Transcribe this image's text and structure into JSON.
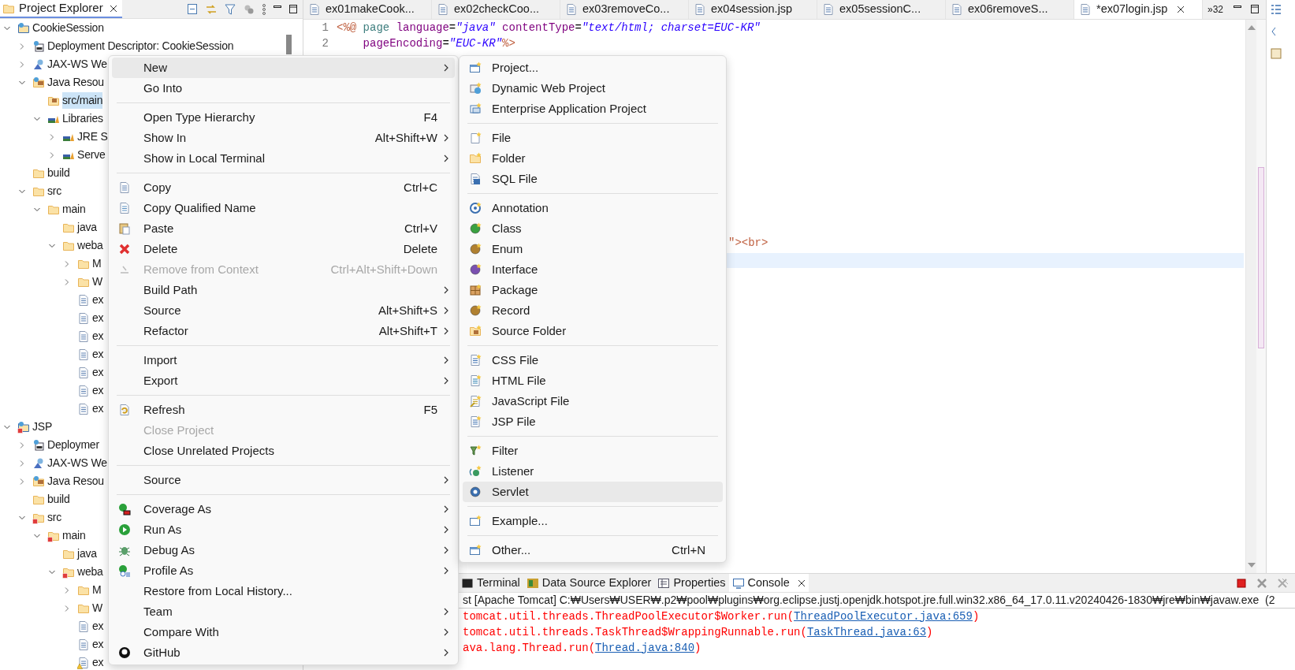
{
  "explorer": {
    "title": "Project Explorer",
    "tree": [
      {
        "label": "CookieSession",
        "kind": "project",
        "expanded": true,
        "children": [
          {
            "label": "Deployment Descriptor: CookieSession",
            "kind": "descriptor",
            "expanded": false
          },
          {
            "label": "JAX-WS We",
            "kind": "webservice",
            "expanded": false
          },
          {
            "label": "Java Resou",
            "kind": "java-resources",
            "expanded": true,
            "children": [
              {
                "label": "src/main",
                "kind": "package-root",
                "selected": true
              },
              {
                "label": "Libraries",
                "kind": "library",
                "expanded": true,
                "children": [
                  {
                    "label": "JRE S",
                    "kind": "library",
                    "expanded": false
                  },
                  {
                    "label": "Serve",
                    "kind": "library",
                    "expanded": false
                  }
                ]
              }
            ]
          },
          {
            "label": "build",
            "kind": "folder"
          },
          {
            "label": "src",
            "kind": "folder",
            "expanded": true,
            "children": [
              {
                "label": "main",
                "kind": "folder",
                "expanded": true,
                "children": [
                  {
                    "label": "java",
                    "kind": "folder"
                  },
                  {
                    "label": "weba",
                    "kind": "folder",
                    "expanded": true,
                    "children": [
                      {
                        "label": "M",
                        "kind": "folder",
                        "expanded": false
                      },
                      {
                        "label": "W",
                        "kind": "folder",
                        "expanded": false
                      },
                      {
                        "label": "ex",
                        "kind": "file"
                      },
                      {
                        "label": "ex",
                        "kind": "file"
                      },
                      {
                        "label": "ex",
                        "kind": "file"
                      },
                      {
                        "label": "ex",
                        "kind": "file"
                      },
                      {
                        "label": "ex",
                        "kind": "file"
                      },
                      {
                        "label": "ex",
                        "kind": "file"
                      },
                      {
                        "label": "ex",
                        "kind": "file"
                      }
                    ]
                  }
                ]
              }
            ]
          }
        ]
      },
      {
        "label": "JSP",
        "kind": "project-error",
        "expanded": true,
        "children": [
          {
            "label": "Deploymer",
            "kind": "descriptor",
            "expanded": false
          },
          {
            "label": "JAX-WS We",
            "kind": "webservice",
            "expanded": false
          },
          {
            "label": "Java Resou",
            "kind": "java-resources",
            "expanded": false
          },
          {
            "label": "build",
            "kind": "folder"
          },
          {
            "label": "src",
            "kind": "folder-error",
            "expanded": true,
            "children": [
              {
                "label": "main",
                "kind": "folder-error",
                "expanded": true,
                "children": [
                  {
                    "label": "java",
                    "kind": "folder"
                  },
                  {
                    "label": "weba",
                    "kind": "folder-error",
                    "expanded": true,
                    "children": [
                      {
                        "label": "M",
                        "kind": "folder",
                        "expanded": false
                      },
                      {
                        "label": "W",
                        "kind": "folder",
                        "expanded": false
                      },
                      {
                        "label": "ex",
                        "kind": "file"
                      },
                      {
                        "label": "ex",
                        "kind": "file"
                      },
                      {
                        "label": "ex",
                        "kind": "file-warning"
                      }
                    ]
                  }
                ]
              }
            ]
          }
        ]
      }
    ]
  },
  "editor": {
    "tabs": [
      {
        "label": "ex01makeCook...",
        "selected": false
      },
      {
        "label": "ex02checkCoo...",
        "selected": false
      },
      {
        "label": "ex03removeCo...",
        "selected": false
      },
      {
        "label": "ex04session.jsp",
        "selected": false
      },
      {
        "label": "ex05sessionC...",
        "selected": false
      },
      {
        "label": "ex06removeS...",
        "selected": false
      },
      {
        "label": "*ex07login.jsp",
        "selected": true
      }
    ],
    "overflow": "»32",
    "lines": [
      {
        "number": "1",
        "segments": [
          {
            "text": "<%@ ",
            "kind": "tag"
          },
          {
            "text": "page ",
            "kind": "keyword"
          },
          {
            "text": "language",
            "kind": "attr"
          },
          {
            "text": "=",
            "kind": "plain"
          },
          {
            "text": "\"java\"",
            "kind": "value"
          },
          {
            "text": " contentType",
            "kind": "attr"
          },
          {
            "text": "=",
            "kind": "plain"
          },
          {
            "text": "\"text/html; charset=EUC-KR\"",
            "kind": "value"
          }
        ]
      },
      {
        "number": "2",
        "segments": [
          {
            "text": "    pageEncoding",
            "kind": "attr"
          },
          {
            "text": "=",
            "kind": "plain"
          },
          {
            "text": "\"EUC-KR\"",
            "kind": "value"
          },
          {
            "text": "%>",
            "kind": "tag"
          }
        ]
      }
    ],
    "fragment": [
      {
        "text": "\"><br>",
        "kind": "tag"
      }
    ]
  },
  "console": {
    "tabs": [
      {
        "label": "Terminal",
        "kind": "terminal",
        "selected": false
      },
      {
        "label": "Data Source Explorer",
        "kind": "database",
        "selected": false
      },
      {
        "label": "Properties",
        "kind": "properties",
        "selected": false
      },
      {
        "label": "Console",
        "kind": "console",
        "selected": true
      }
    ],
    "header": "st [Apache Tomcat] C:₩Users₩USER₩.p2₩pool₩plugins₩org.eclipse.justj.openjdk.hotspot.jre.full.win32.x86_64_17.0.11.v20240426-1830₩jre₩bin₩javaw.exe  (2",
    "lines": [
      [
        {
          "kind": "text",
          "text": "tomcat.util.threads.ThreadPoolExecutor$Worker.run("
        },
        {
          "kind": "link",
          "text": "ThreadPoolExecutor.java:659"
        },
        {
          "kind": "text",
          "text": ")"
        }
      ],
      [
        {
          "kind": "text",
          "text": "tomcat.util.threads.TaskThread$WrappingRunnable.run("
        },
        {
          "kind": "link",
          "text": "TaskThread.java:63"
        },
        {
          "kind": "text",
          "text": ")"
        }
      ],
      [
        {
          "kind": "text",
          "text": "ava.lang.Thread.run("
        },
        {
          "kind": "link",
          "text": "Thread.java:840"
        },
        {
          "kind": "text",
          "text": ")"
        }
      ]
    ]
  },
  "context_menu": [
    {
      "kind": "item",
      "label": "New",
      "submenu": true,
      "selected": true,
      "disabled": false
    },
    {
      "kind": "item",
      "label": "Go Into",
      "submenu": false,
      "selected": false,
      "disabled": false
    },
    {
      "kind": "separator"
    },
    {
      "kind": "item",
      "label": "Open Type Hierarchy",
      "shortcut": "F4",
      "submenu": false,
      "selected": false,
      "disabled": false
    },
    {
      "kind": "item",
      "label": "Show In",
      "shortcut": "Alt+Shift+W",
      "submenu": true,
      "selected": false,
      "disabled": false
    },
    {
      "kind": "item",
      "label": "Show in Local Terminal",
      "submenu": true,
      "selected": false,
      "disabled": false
    },
    {
      "kind": "separator"
    },
    {
      "kind": "copy",
      "label": "Copy",
      "shortcut": "Ctrl+C",
      "submenu": false,
      "selected": false,
      "disabled": false
    },
    {
      "kind": "copy-name",
      "label": "Copy Qualified Name",
      "submenu": false,
      "selected": false,
      "disabled": false
    },
    {
      "kind": "paste",
      "label": "Paste",
      "shortcut": "Ctrl+V",
      "submenu": false,
      "selected": false,
      "disabled": false
    },
    {
      "kind": "delete",
      "label": "Delete",
      "shortcut": "Delete",
      "submenu": false,
      "selected": false,
      "disabled": false
    },
    {
      "kind": "remove",
      "label": "Remove from Context",
      "shortcut": "Ctrl+Alt+Shift+Down",
      "submenu": false,
      "selected": false,
      "disabled": true
    },
    {
      "kind": "item",
      "label": "Build Path",
      "submenu": true,
      "selected": false,
      "disabled": false
    },
    {
      "kind": "item",
      "label": "Source",
      "shortcut": "Alt+Shift+S",
      "submenu": true,
      "selected": false,
      "disabled": false
    },
    {
      "kind": "item",
      "label": "Refactor",
      "shortcut": "Alt+Shift+T",
      "submenu": true,
      "selected": false,
      "disabled": false
    },
    {
      "kind": "separator"
    },
    {
      "kind": "item",
      "label": "Import",
      "submenu": true,
      "selected": false,
      "disabled": false
    },
    {
      "kind": "item",
      "label": "Export",
      "submenu": true,
      "selected": false,
      "disabled": false
    },
    {
      "kind": "separator"
    },
    {
      "kind": "refresh",
      "label": "Refresh",
      "shortcut": "F5",
      "submenu": false,
      "selected": false,
      "disabled": false
    },
    {
      "kind": "item",
      "label": "Close Project",
      "submenu": false,
      "selected": false,
      "disabled": true
    },
    {
      "kind": "item",
      "label": "Close Unrelated Projects",
      "submenu": false,
      "selected": false,
      "disabled": false
    },
    {
      "kind": "separator"
    },
    {
      "kind": "item",
      "label": "Source",
      "submenu": true,
      "selected": false,
      "disabled": false
    },
    {
      "kind": "separator"
    },
    {
      "kind": "coverage",
      "label": "Coverage As",
      "submenu": true,
      "selected": false,
      "disabled": false
    },
    {
      "kind": "run",
      "label": "Run As",
      "submenu": true,
      "selected": false,
      "disabled": false
    },
    {
      "kind": "debug",
      "label": "Debug As",
      "submenu": true,
      "selected": false,
      "disabled": false
    },
    {
      "kind": "profile",
      "label": "Profile As",
      "submenu": true,
      "selected": false,
      "disabled": false
    },
    {
      "kind": "item",
      "label": "Restore from Local History...",
      "submenu": false,
      "selected": false,
      "disabled": false
    },
    {
      "kind": "item",
      "label": "Team",
      "submenu": true,
      "selected": false,
      "disabled": false
    },
    {
      "kind": "item",
      "label": "Compare With",
      "submenu": true,
      "selected": false,
      "disabled": false
    },
    {
      "kind": "github",
      "label": "GitHub",
      "submenu": true,
      "selected": false,
      "disabled": false
    }
  ],
  "new_submenu": [
    {
      "kind": "project-new",
      "label": "Project...",
      "selected": false
    },
    {
      "kind": "web-project",
      "label": "Dynamic Web Project",
      "selected": false
    },
    {
      "kind": "ear-project",
      "label": "Enterprise Application Project",
      "selected": false
    },
    {
      "kind": "separator"
    },
    {
      "kind": "file-new",
      "label": "File",
      "selected": false
    },
    {
      "kind": "folder-new",
      "label": "Folder",
      "selected": false
    },
    {
      "kind": "sql-file",
      "label": "SQL File",
      "selected": false
    },
    {
      "kind": "separator"
    },
    {
      "kind": "annotation",
      "label": "Annotation",
      "selected": false
    },
    {
      "kind": "class",
      "label": "Class",
      "selected": false
    },
    {
      "kind": "enum",
      "label": "Enum",
      "selected": false
    },
    {
      "kind": "interface",
      "label": "Interface",
      "selected": false
    },
    {
      "kind": "package",
      "label": "Package",
      "selected": false
    },
    {
      "kind": "record",
      "label": "Record",
      "selected": false
    },
    {
      "kind": "source-folder",
      "label": "Source Folder",
      "selected": false
    },
    {
      "kind": "separator"
    },
    {
      "kind": "css-file",
      "label": "CSS File",
      "selected": false
    },
    {
      "kind": "html-file",
      "label": "HTML File",
      "selected": false
    },
    {
      "kind": "js-file",
      "label": "JavaScript File",
      "selected": false
    },
    {
      "kind": "jsp-file",
      "label": "JSP File",
      "selected": false
    },
    {
      "kind": "separator"
    },
    {
      "kind": "filter",
      "label": "Filter",
      "selected": false
    },
    {
      "kind": "listener",
      "label": "Listener",
      "selected": false
    },
    {
      "kind": "servlet",
      "label": "Servlet",
      "selected": true
    },
    {
      "kind": "separator"
    },
    {
      "kind": "example",
      "label": "Example...",
      "selected": false
    },
    {
      "kind": "separator"
    },
    {
      "kind": "other",
      "label": "Other...",
      "shortcut": "Ctrl+N",
      "selected": false
    }
  ]
}
